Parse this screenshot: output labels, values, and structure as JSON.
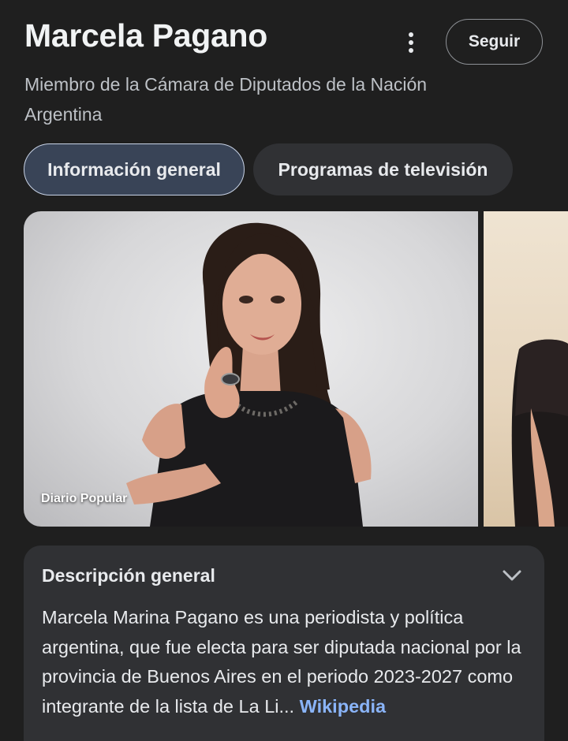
{
  "header": {
    "title": "Marcela Pagano",
    "subtitle": "Miembro de la Cámara de Diputados de la Nación Argentina",
    "follow_label": "Seguir",
    "more_icon": "more-vert-icon"
  },
  "tabs": [
    {
      "label": "Información general",
      "active": true
    },
    {
      "label": "Programas de televisión",
      "active": false
    }
  ],
  "images": {
    "main_source": "Diario Popular"
  },
  "description": {
    "title": "Descripción general",
    "chevron_icon": "chevron-down-icon",
    "text": "Marcela Marina Pagano  es una periodista y política argentina, que fue electa para ser diputada nacional por la provincia de Buenos Aires en el periodo 2023-2027 como integrante de la lista de La Li...",
    "link_label": "Wikipedia"
  },
  "colors": {
    "background": "#1f1f1f",
    "card": "#303134",
    "active_tab": "#394457",
    "link": "#8ab4f8"
  }
}
